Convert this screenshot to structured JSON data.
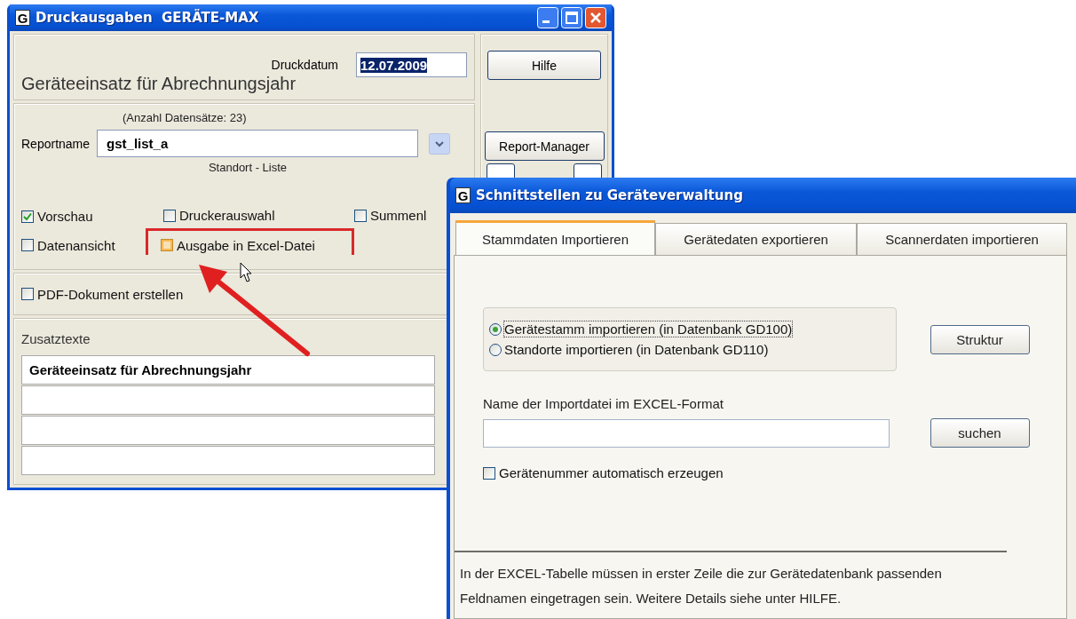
{
  "print_window": {
    "logo": "G",
    "title": "Druckausgaben  GERÄTE-MAX",
    "print_date": {
      "label": "Druckdatum",
      "value": "12.07.2009"
    },
    "heading": "Geräteeinsatz für Abrechnungsjahr",
    "record_count": "(Anzahl Datensätze: 23)",
    "report": {
      "label": "Reportname",
      "value": "gst_list_a",
      "description": "Standort - Liste"
    },
    "options": [
      {
        "label": "Vorschau",
        "checked": true,
        "hovered": false,
        "highlighted": false
      },
      {
        "label": "Druckerauswahl",
        "checked": false,
        "hovered": false,
        "highlighted": false
      },
      {
        "label": "Summenl",
        "checked": false,
        "hovered": false,
        "highlighted": false
      },
      {
        "label": "Datenansicht",
        "checked": false,
        "hovered": false,
        "highlighted": false
      },
      {
        "label": "Ausgabe in Excel-Datei",
        "checked": false,
        "hovered": true,
        "highlighted": true
      }
    ],
    "pdf_option": {
      "label": "PDF-Dokument erstellen",
      "checked": false
    },
    "extra_texts": {
      "label": "Zusatztexte",
      "fields": [
        {
          "kind": "filled",
          "value": "Geräteeinsatz für Abrechnungsjahr"
        },
        {
          "kind": "blank"
        },
        {
          "kind": "blank"
        },
        {
          "kind": "blank"
        }
      ]
    },
    "buttons": [
      "Hilfe",
      "Report-Manager"
    ]
  },
  "import_window": {
    "logo": "G",
    "title": "Schnittstellen zu Geräteverwaltung",
    "tabs": [
      {
        "label": "Stammdaten Importieren",
        "selected": true
      },
      {
        "label": "Gerätedaten exportieren",
        "selected": false
      },
      {
        "label": "Scannerdaten importieren",
        "selected": false
      }
    ],
    "import_source": [
      {
        "label": "Gerätestamm importieren (in Datenbank GD100)",
        "selected": true
      },
      {
        "label": "Standorte importieren (in Datenbank GD110)",
        "selected": false
      }
    ],
    "structure_button": "Struktur",
    "file": {
      "label": "Name der Importdatei im EXCEL-Format"
    },
    "search_button": "suchen",
    "auto_number": {
      "label": "Gerätenummer automatisch erzeugen",
      "checked": false
    },
    "info": "In der EXCEL-Tabelle müssen in erster Zeile die zur Gerätedatenbank passenden Feldnamen eingetragen sein. Weitere Details siehe unter HILFE."
  }
}
